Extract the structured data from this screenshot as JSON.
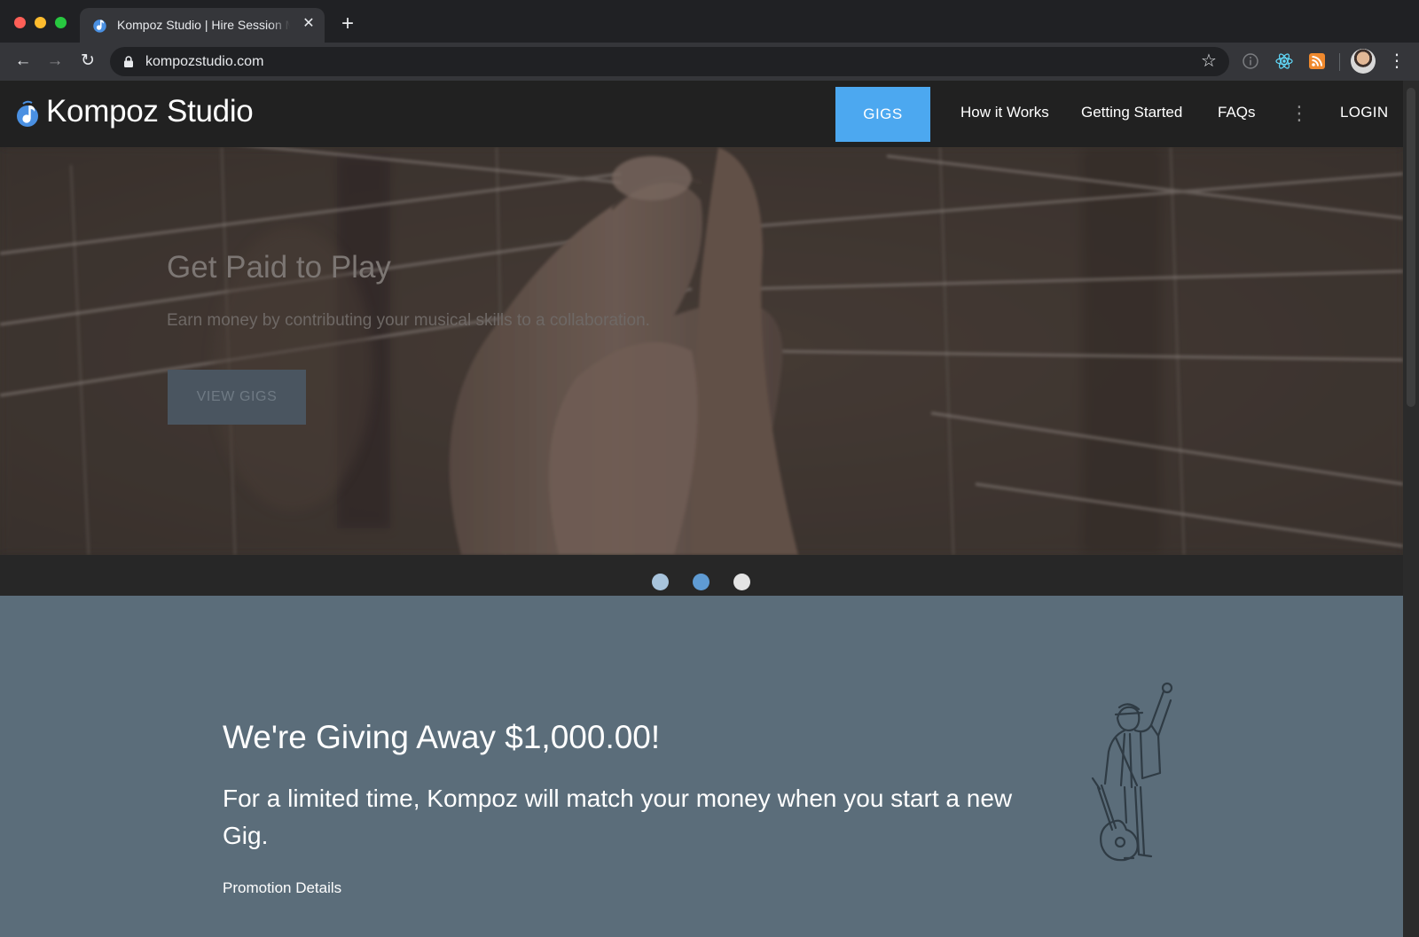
{
  "browser": {
    "tab_title": "Kompoz Studio | Hire Session Musicians",
    "tab_favicon": "kompoz-note-icon",
    "close_icon": "close-icon",
    "new_tab_icon": "plus-icon",
    "url": "kompozstudio.com",
    "nav": {
      "back": "←",
      "forward": "→",
      "reload": "↻"
    },
    "star_icon": "☆",
    "menu_icon": "⋮"
  },
  "site": {
    "brand": "Kompoz Studio",
    "nav": {
      "gigs": "GIGS",
      "how_it_works": "How it Works",
      "getting_started": "Getting Started",
      "faqs": "FAQs",
      "more": "⋮",
      "login": "LOGIN"
    },
    "hero": {
      "title": "Get Paid to Play",
      "subtitle": "Earn money by contributing your musical skills to a collaboration.",
      "cta": "VIEW GIGS",
      "slides": 3,
      "active_slide": 2
    },
    "promo": {
      "title": "We're Giving Away $1,000.00!",
      "body": "For a limited time, Kompoz will match your money when you start a new Gig.",
      "link": "Promotion Details"
    }
  },
  "colors": {
    "accent": "#4ca8f0",
    "nav_bg": "#212121",
    "promo_bg": "#5b6d7a",
    "dot_active": "#5f9bd3"
  }
}
